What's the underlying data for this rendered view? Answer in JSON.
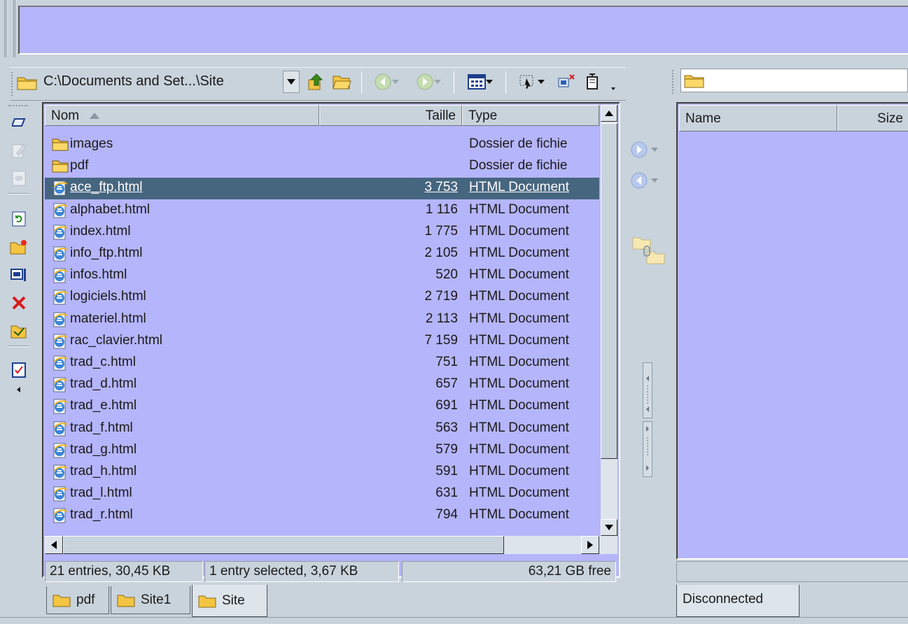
{
  "left_panel": {
    "path": "C:\\Documents and Set...\\Site",
    "columns": {
      "name": "Nom",
      "size": "Taille",
      "type": "Type"
    },
    "files": [
      {
        "name": "images",
        "size": "",
        "type": "Dossier de fichie",
        "icon": "folder-icon"
      },
      {
        "name": "pdf",
        "size": "",
        "type": "Dossier de fichie",
        "icon": "folder-icon"
      },
      {
        "name": "ace_ftp.html",
        "size": "3 753",
        "type": "HTML Document",
        "icon": "html-file-icon",
        "selected": true
      },
      {
        "name": "alphabet.html",
        "size": "1 116",
        "type": "HTML Document",
        "icon": "html-file-icon"
      },
      {
        "name": "index.html",
        "size": "1 775",
        "type": "HTML Document",
        "icon": "html-file-icon"
      },
      {
        "name": "info_ftp.html",
        "size": "2 105",
        "type": "HTML Document",
        "icon": "html-file-icon"
      },
      {
        "name": "infos.html",
        "size": "520",
        "type": "HTML Document",
        "icon": "html-file-icon"
      },
      {
        "name": "logiciels.html",
        "size": "2 719",
        "type": "HTML Document",
        "icon": "html-file-icon"
      },
      {
        "name": "materiel.html",
        "size": "2 113",
        "type": "HTML Document",
        "icon": "html-file-icon"
      },
      {
        "name": "rac_clavier.html",
        "size": "7 159",
        "type": "HTML Document",
        "icon": "html-file-icon"
      },
      {
        "name": "trad_c.html",
        "size": "751",
        "type": "HTML Document",
        "icon": "html-file-icon"
      },
      {
        "name": "trad_d.html",
        "size": "657",
        "type": "HTML Document",
        "icon": "html-file-icon"
      },
      {
        "name": "trad_e.html",
        "size": "691",
        "type": "HTML Document",
        "icon": "html-file-icon"
      },
      {
        "name": "trad_f.html",
        "size": "563",
        "type": "HTML Document",
        "icon": "html-file-icon"
      },
      {
        "name": "trad_g.html",
        "size": "579",
        "type": "HTML Document",
        "icon": "html-file-icon"
      },
      {
        "name": "trad_h.html",
        "size": "591",
        "type": "HTML Document",
        "icon": "html-file-icon"
      },
      {
        "name": "trad_l.html",
        "size": "631",
        "type": "HTML Document",
        "icon": "html-file-icon"
      },
      {
        "name": "trad_r.html",
        "size": "794",
        "type": "HTML Document",
        "icon": "html-file-icon"
      }
    ],
    "status": {
      "entries": "21 entries, 30,45 KB",
      "selection": "1 entry selected, 3,67 KB",
      "free": "63,21 GB free"
    },
    "tabs": [
      {
        "label": "pdf",
        "icon": "folder-icon"
      },
      {
        "label": "Site1",
        "icon": "folder-icon"
      },
      {
        "label": "Site",
        "icon": "folder-icon",
        "active": true
      }
    ]
  },
  "right_panel": {
    "path": "",
    "columns": {
      "name": "Name",
      "size": "Size"
    },
    "status": "",
    "tab": "Disconnected"
  },
  "colors": {
    "list_background": "#b5b5fb",
    "selection": "#46657f",
    "chrome": "#c9d3dc"
  }
}
